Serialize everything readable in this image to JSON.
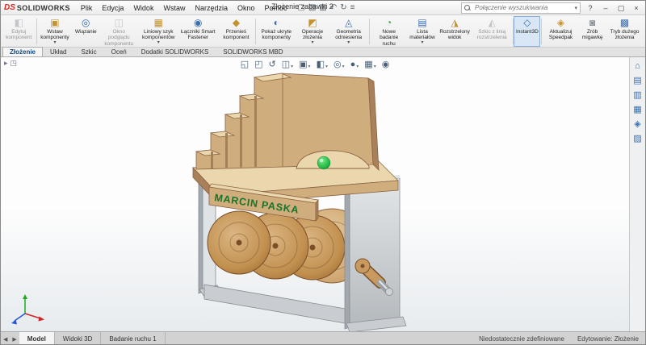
{
  "theme": {
    "accent": "#2b78c5",
    "sw_red": "#e2231a",
    "wood_light": "#ead7ae",
    "wood_mid": "#d0ad7c",
    "wood_dark": "#a8815a",
    "metal_light": "#e0e3e6",
    "metal_mid": "#c9cdd1",
    "metal_dark": "#a2a8ad",
    "ball_green": "#2fc34e",
    "engraving_green": "#15752a",
    "icon_amber": "#c4922f",
    "icon_blue": "#3a6fb0",
    "icon_green": "#3f9a47",
    "icon_gray": "#8a9096"
  },
  "titlebar": {
    "logo_mark": "DS",
    "logo_text": "SOLIDWORKS",
    "menus": [
      "Plik",
      "Edycja",
      "Widok",
      "Wstaw",
      "Narzędzia",
      "Okno",
      "Pomoc"
    ],
    "quick_access": [
      {
        "glyph": "▢"
      },
      {
        "glyph": "▧"
      },
      {
        "glyph": "▥"
      },
      {
        "glyph": "↶"
      },
      {
        "glyph": "↻"
      },
      {
        "glyph": "≡"
      }
    ],
    "document_title": "Złożenie zabawki 2",
    "search_placeholder": "Połączenie wyszukiwania",
    "search_chevron": "▾",
    "help_label": "?",
    "window_controls": [
      "–",
      "▢",
      "×"
    ]
  },
  "ribbon": {
    "buttons": [
      {
        "label": "Edytuj komponent",
        "glyph": "◧",
        "state": "disabled"
      },
      {
        "label": "Wstaw komponenty",
        "glyph": "▣",
        "state": "normal",
        "chevron": "▾"
      },
      {
        "label": "Wiązanie",
        "glyph": "◎",
        "state": "normal"
      },
      {
        "label": "Okno podglądu komponentu",
        "glyph": "◫",
        "state": "disabled"
      },
      {
        "label": "Liniowy szyk komponentów",
        "glyph": "▦",
        "state": "normal",
        "chevron": "▾"
      },
      {
        "label": "Łączniki Smart Fastener",
        "glyph": "◉",
        "state": "normal"
      },
      {
        "label": "Przenieś komponent",
        "glyph": "◆",
        "state": "normal"
      },
      {
        "label": "Pokaż ukryte komponenty",
        "glyph": "◐",
        "state": "normal"
      },
      {
        "label": "Operacje złożenia",
        "glyph": "◩",
        "state": "normal",
        "chevron": "▾"
      },
      {
        "label": "Geometria odniesienia",
        "glyph": "◬",
        "state": "normal",
        "chevron": "▾"
      },
      {
        "label": "Nowe badanie ruchu",
        "glyph": "◔",
        "state": "normal"
      },
      {
        "label": "Lista materiałów",
        "glyph": "▤",
        "state": "normal",
        "chevron": "▾"
      },
      {
        "label": "Rozstrzelony widok",
        "glyph": "◮",
        "state": "normal"
      },
      {
        "label": "Szkic z linią rozstrzelenia",
        "glyph": "◭",
        "state": "disabled"
      },
      {
        "label": "Instant3D",
        "glyph": "◇",
        "state": "active"
      },
      {
        "label": "Aktualizuj Speedpak",
        "glyph": "◈",
        "state": "normal"
      },
      {
        "label": "Zrób migawkę",
        "glyph": "◙",
        "state": "normal"
      },
      {
        "label": "Tryb dużego złożenia",
        "glyph": "▩",
        "state": "normal"
      }
    ]
  },
  "tabs": {
    "items": [
      "Złożenie",
      "Układ",
      "Szkic",
      "Oceń",
      "Dodatki SOLIDWORKS",
      "SOLIDWORKS MBD"
    ],
    "active_index": 0
  },
  "viewport": {
    "flyout": [
      {
        "glyph": "▸"
      },
      {
        "glyph": "◳"
      }
    ],
    "hud": [
      {
        "glyph": "◱"
      },
      {
        "glyph": "◰"
      },
      {
        "glyph": "↺"
      },
      {
        "glyph": "◫",
        "chevron": "▾"
      },
      {
        "glyph": "▣",
        "chevron": "▾"
      },
      {
        "glyph": "◧",
        "chevron": "▾"
      },
      {
        "glyph": "◎",
        "chevron": "▾"
      },
      {
        "glyph": "●",
        "chevron": "▾"
      },
      {
        "glyph": "▦",
        "chevron": "▾"
      },
      {
        "glyph": "◉"
      }
    ],
    "model": {
      "engraving": "MARCIN PASKA"
    }
  },
  "task_pane": {
    "icons": [
      {
        "glyph": "⌂"
      },
      {
        "glyph": "▤"
      },
      {
        "glyph": "▥"
      },
      {
        "glyph": "▦"
      },
      {
        "glyph": "◈"
      },
      {
        "glyph": "▨"
      }
    ]
  },
  "bottom": {
    "scroll_left": "◀",
    "scroll_right": "▶",
    "tabs": [
      "Model",
      "Widoki 3D",
      "Badanie ruchu 1"
    ],
    "active_index": 0,
    "status_left": "Niedostatecznie zdefiniowane",
    "status_right": "Edytowanie: Złożenie"
  }
}
